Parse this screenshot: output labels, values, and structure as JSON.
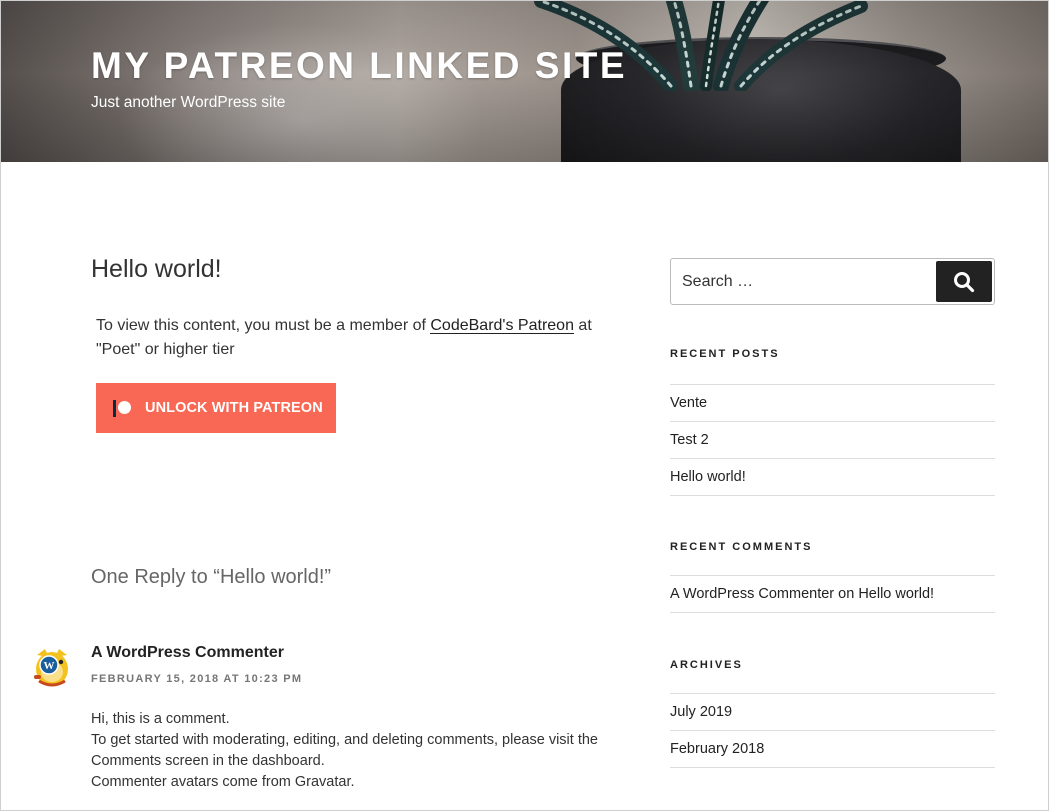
{
  "header": {
    "site_title": "MY PATREON LINKED SITE",
    "site_description": "Just another WordPress site"
  },
  "post": {
    "title": "Hello world!",
    "locked_message_prefix": "To view this content, you must be a member of ",
    "locked_message_link": "CodeBard's Patreon",
    "locked_message_suffix": " at \"Poet\" or higher tier",
    "unlock_button_label": "UNLOCK WITH PATREON",
    "patreon_brand_color": "#f96854"
  },
  "comments": {
    "heading": "One Reply to “Hello world!”",
    "items": [
      {
        "author": "A WordPress Commenter",
        "date": "FEBRUARY 15, 2018 AT 10:23 PM",
        "avatar_icon": "wapuu-avatar-icon",
        "lines": [
          "Hi, this is a comment.",
          "To get started with moderating, editing, and deleting comments, please visit the Comments screen in the dashboard.",
          "Commenter avatars come from Gravatar."
        ]
      }
    ]
  },
  "sidebar": {
    "search": {
      "placeholder": "Search …",
      "button_icon": "search-icon"
    },
    "recent_posts": {
      "title": "RECENT POSTS",
      "items": [
        "Vente",
        "Test 2",
        "Hello world!"
      ]
    },
    "recent_comments": {
      "title": "RECENT COMMENTS",
      "items": [
        {
          "author": "A WordPress Commenter",
          "on": " on ",
          "post": "Hello world!"
        }
      ]
    },
    "archives": {
      "title": "ARCHIVES",
      "items": [
        "July 2019",
        "February 2018"
      ]
    }
  }
}
